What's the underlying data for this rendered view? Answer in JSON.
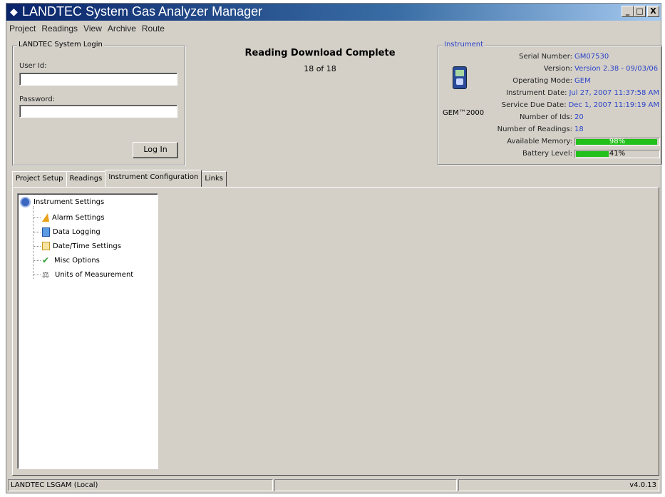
{
  "window": {
    "title": "LANDTEC System Gas Analyzer Manager"
  },
  "window_buttons": {
    "minimize": "_",
    "maximize": "□",
    "close": "X"
  },
  "menu": [
    "Project",
    "Readings",
    "View",
    "Archive",
    "Route"
  ],
  "login": {
    "group_title": "LANDTEC System Login",
    "user_label": "User Id:",
    "user_value": "",
    "password_label": "Password:",
    "password_value": "",
    "button_label": "Log In"
  },
  "status": {
    "headline": "Reading Download Complete",
    "progress": "18 of 18"
  },
  "instrument": {
    "group_title": "Instrument",
    "device_name": "GEM™2000",
    "fields": [
      {
        "label": "Serial Number:",
        "value": "GM07530"
      },
      {
        "label": "Version:",
        "value": "Version 2.38 - 09/03/06"
      },
      {
        "label": "Operating Mode:",
        "value": "GEM"
      },
      {
        "label": "Instrument Date:",
        "value": "Jul 27, 2007 11:37:58 AM"
      },
      {
        "label": "Service Due Date:",
        "value": "Dec 1, 2007 11:19:19 AM"
      },
      {
        "label": "Number of Ids:",
        "value": "20"
      },
      {
        "label": "Number of Readings:",
        "value": "18"
      }
    ],
    "memory": {
      "label": "Available Memory:",
      "percent": 98,
      "text": "98%"
    },
    "battery": {
      "label": "Battery Level:",
      "percent": 41,
      "text": "41%"
    },
    "bar_color": "#22c01a"
  },
  "tabs": [
    {
      "label": "Project Setup",
      "active": false
    },
    {
      "label": "Readings",
      "active": false
    },
    {
      "label": "Instrument Configuration",
      "active": true
    },
    {
      "label": "Links",
      "active": false
    }
  ],
  "tree": {
    "root": {
      "label": "Instrument Settings",
      "icon": "gear-icon"
    },
    "children": [
      {
        "label": "Alarm Settings",
        "icon": "alarm-bell-icon"
      },
      {
        "label": "Data Logging",
        "icon": "document-icon"
      },
      {
        "label": "Date/Time Settings",
        "icon": "calendar-icon"
      },
      {
        "label": "Misc Options",
        "icon": "checkmark-icon"
      },
      {
        "label": "Units of Measurement",
        "icon": "scale-icon"
      }
    ]
  },
  "statusbar": {
    "left": "LANDTEC LSGAM (Local)",
    "middle": "",
    "middle2": "",
    "version": "v4.0.13"
  }
}
